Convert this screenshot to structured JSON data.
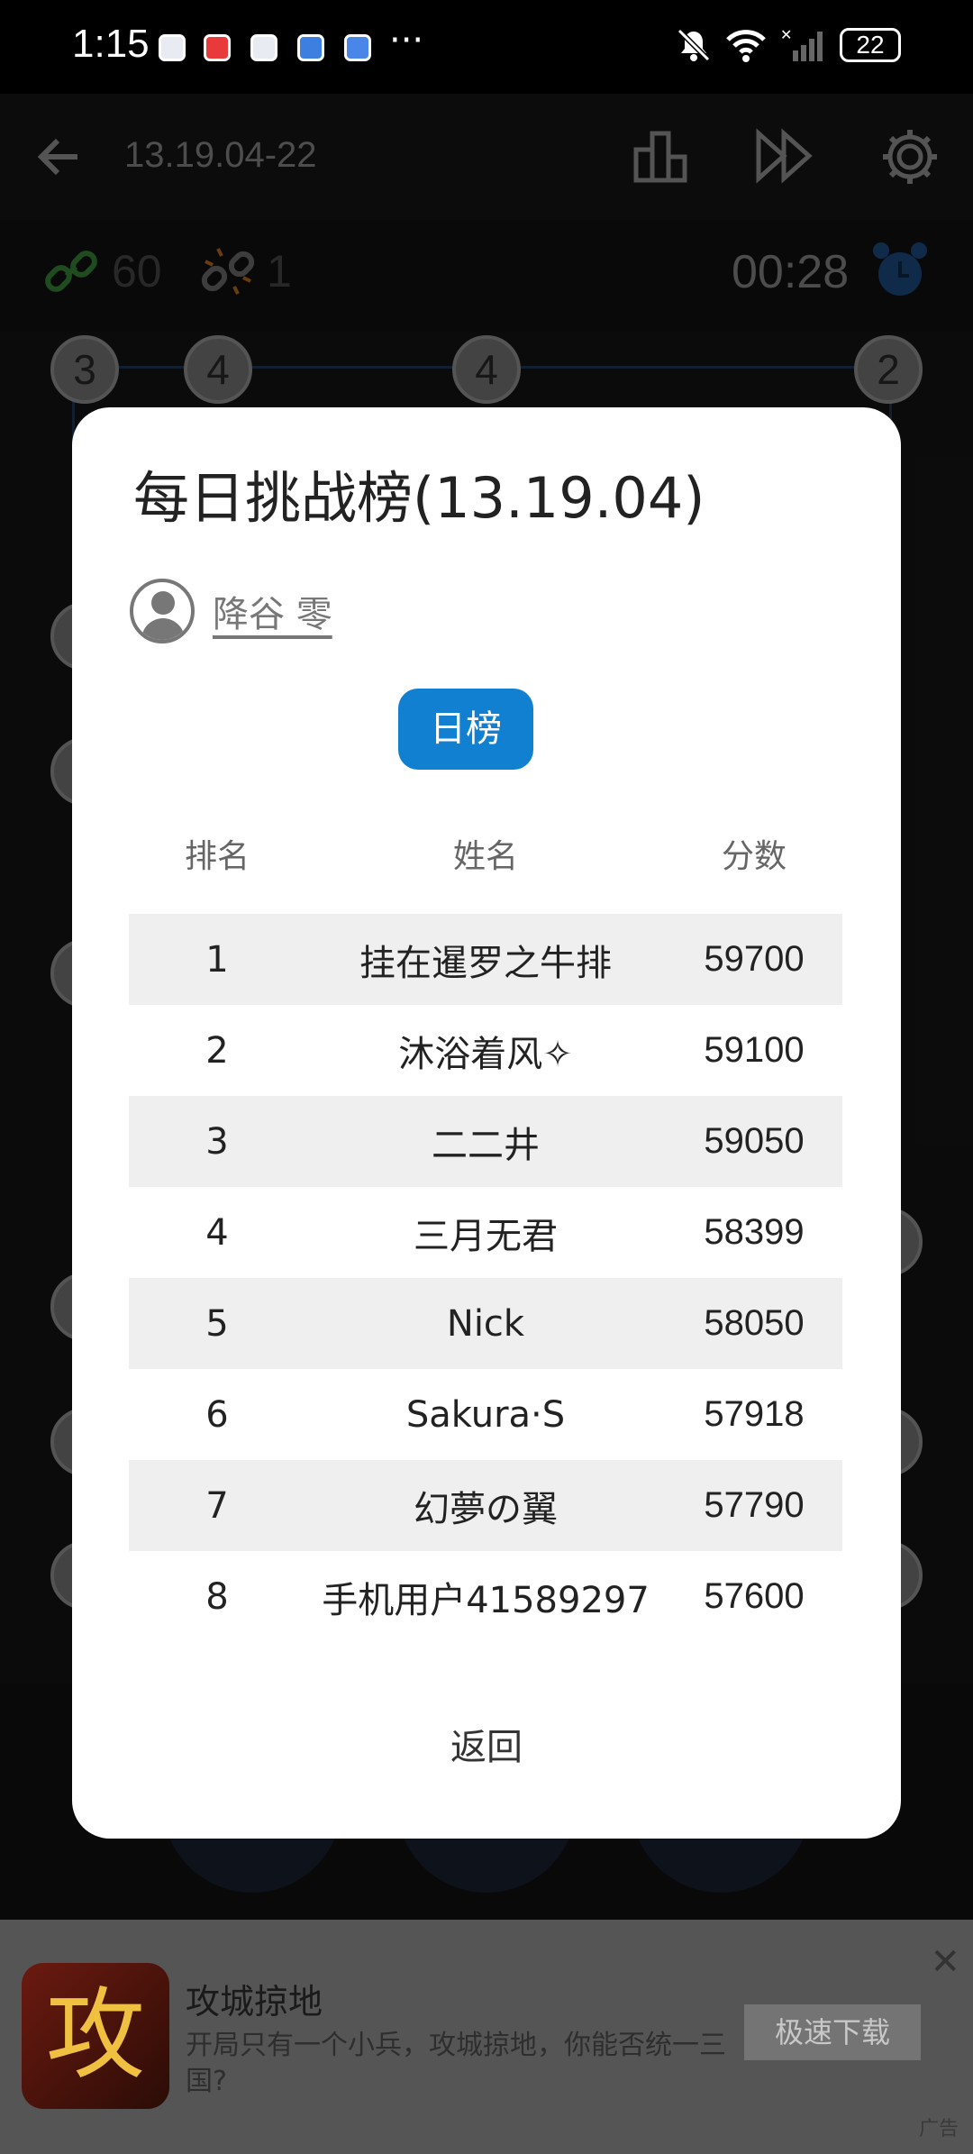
{
  "status_bar": {
    "time": "1:15",
    "more": "···",
    "battery": "22"
  },
  "app_bar": {
    "title": "13.19.04-22"
  },
  "info_bar": {
    "links_count": "60",
    "broken_count": "1",
    "timer": "00:28"
  },
  "board_nodes": [
    "3",
    "4",
    "4",
    "2"
  ],
  "dialog": {
    "title": "每日挑战榜(13.19.04)",
    "user_name": "降谷 零",
    "tab_label": "日榜",
    "columns": {
      "rank": "排名",
      "name": "姓名",
      "score": "分数"
    },
    "rows": [
      {
        "rank": "1",
        "name": "挂在暹罗之牛排",
        "score": "59700"
      },
      {
        "rank": "2",
        "name": "沐浴着风✧",
        "score": "59100"
      },
      {
        "rank": "3",
        "name": "二二井",
        "score": "59050"
      },
      {
        "rank": "4",
        "name": "三月无君",
        "score": "58399"
      },
      {
        "rank": "5",
        "name": "Nick",
        "score": "58050"
      },
      {
        "rank": "6",
        "name": "Sakura·S",
        "score": "57918"
      },
      {
        "rank": "7",
        "name": "幻夢の翼",
        "score": "57790"
      },
      {
        "rank": "8",
        "name": "手机用户41589297",
        "score": "57600"
      }
    ],
    "back_label": "返回"
  },
  "ad": {
    "logo_char": "攻",
    "title": "攻城掠地",
    "description": "开局只有一个小兵，攻城掠地，你能否统一三国?",
    "button": "极速下载",
    "close": "✕",
    "tag": "广告"
  },
  "colors": {
    "accent": "#1180d0",
    "row_shade": "#efefef",
    "ad_bg": "#555555"
  }
}
